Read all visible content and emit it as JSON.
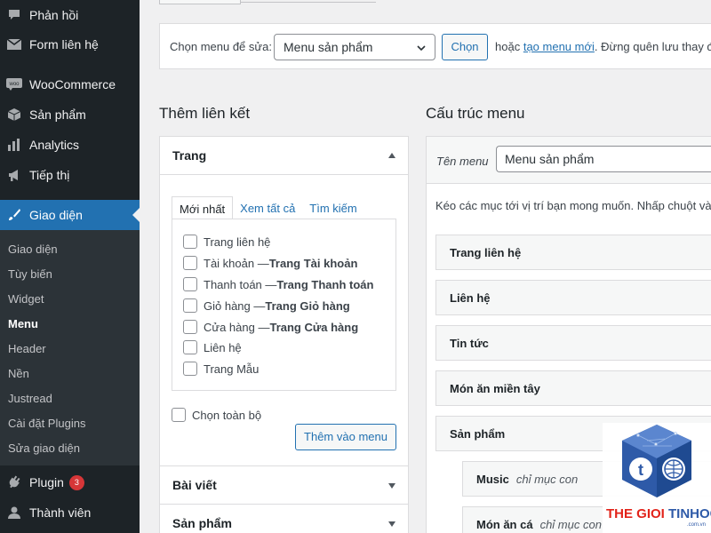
{
  "sidebar": {
    "items": [
      {
        "label": "Phản hồi",
        "icon": "comment-icon"
      },
      {
        "label": "Form liên hệ",
        "icon": "mail-icon"
      },
      {
        "label": "WooCommerce",
        "icon": "woocommerce-icon"
      },
      {
        "label": "Sản phẩm",
        "icon": "box-icon"
      },
      {
        "label": "Analytics",
        "icon": "bar-chart-icon"
      },
      {
        "label": "Tiếp thị",
        "icon": "megaphone-icon"
      },
      {
        "label": "Giao diện",
        "icon": "paintbrush-icon"
      },
      {
        "label": "Plugin",
        "icon": "plugin-icon",
        "badge": "3"
      },
      {
        "label": "Thành viên",
        "icon": "user-icon"
      }
    ],
    "submenu": [
      "Giao diện",
      "Tùy biến",
      "Widget",
      "Menu",
      "Header",
      "Nền",
      "Justread",
      "Cài đặt Plugins",
      "Sửa giao diện"
    ],
    "current_submenu": "Menu"
  },
  "manage": {
    "label": "Chọn menu để sửa:",
    "select_value": "Menu sản phẩm",
    "select_button": "Chọn",
    "or_text": "hoặc",
    "create_link": "tạo menu mới",
    "reminder": ". Đừng quên lưu thay đ"
  },
  "left": {
    "heading": "Thêm liên kết",
    "pages_panel": "Trang",
    "tabs": [
      "Mới nhất",
      "Xem tất cả",
      "Tìm kiếm"
    ],
    "pages": [
      {
        "title": "Trang liên hệ",
        "suffix": ""
      },
      {
        "title": "Tài khoản — ",
        "suffix": "Trang Tài khoản"
      },
      {
        "title": "Thanh toán — ",
        "suffix": "Trang Thanh toán"
      },
      {
        "title": "Giỏ hàng — ",
        "suffix": "Trang Giỏ hàng"
      },
      {
        "title": "Cửa hàng — ",
        "suffix": "Trang Cửa hàng"
      },
      {
        "title": "Liên hệ",
        "suffix": ""
      },
      {
        "title": "Trang Mẫu",
        "suffix": ""
      }
    ],
    "select_all": "Chọn toàn bộ",
    "add_button": "Thêm vào menu",
    "posts_panel": "Bài viết",
    "products_panel": "Sản phẩm"
  },
  "right": {
    "heading": "Cấu trúc menu",
    "name_label": "Tên menu",
    "name_value": "Menu sản phẩm",
    "instructions": "Kéo các mục tới vị trí bạn mong muốn. Nhấp chuột và",
    "items": [
      {
        "label": "Trang liên hệ",
        "sub": ""
      },
      {
        "label": "Liên hệ",
        "sub": ""
      },
      {
        "label": "Tin tức",
        "sub": ""
      },
      {
        "label": "Món ăn miền tây",
        "sub": ""
      },
      {
        "label": "Sản phẩm",
        "sub": ""
      },
      {
        "label": "Music",
        "sub": "chỉ mục con"
      },
      {
        "label": "Món ăn cá",
        "sub": "chỉ mục con"
      }
    ]
  },
  "watermark": {
    "text1": "THE GIOI",
    "text2": "TINHOC",
    "domain": ".com.vn"
  }
}
